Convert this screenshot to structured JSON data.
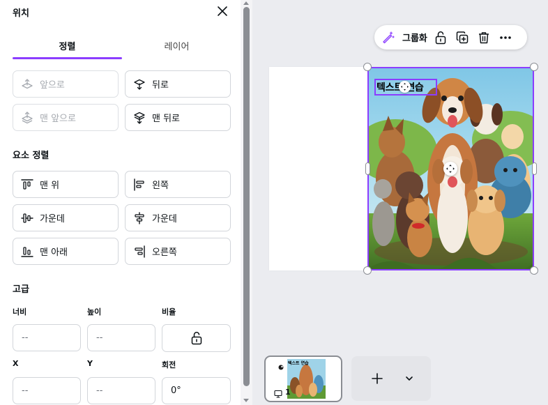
{
  "panel": {
    "title": "위치",
    "tabs": {
      "align": "정렬",
      "layer": "레이어"
    },
    "layer_buttons": {
      "forward": "앞으로",
      "backward": "뒤로",
      "to_front": "맨 앞으로",
      "to_back": "맨 뒤로"
    },
    "element_align_title": "요소 정렬",
    "align_buttons": {
      "top": "맨 위",
      "left": "왼쪽",
      "middle": "가운데",
      "center": "가운데",
      "bottom": "맨 아래",
      "right": "오른쪽"
    },
    "advanced_title": "고급",
    "fields": {
      "width_label": "너비",
      "height_label": "높이",
      "ratio_label": "비율",
      "x_label": "X",
      "y_label": "Y",
      "rotation_label": "회전",
      "width_value": "--",
      "height_value": "--",
      "x_value": "--",
      "y_value": "--",
      "rotation_value": "0°"
    }
  },
  "toolbar": {
    "group_label": "그룹화"
  },
  "canvas": {
    "text_element": "텍스트 연습"
  },
  "pages": {
    "current_page_number": "1",
    "thumbnail_text": "텍스트 연습"
  },
  "colors": {
    "accent": "#8b3dff"
  }
}
